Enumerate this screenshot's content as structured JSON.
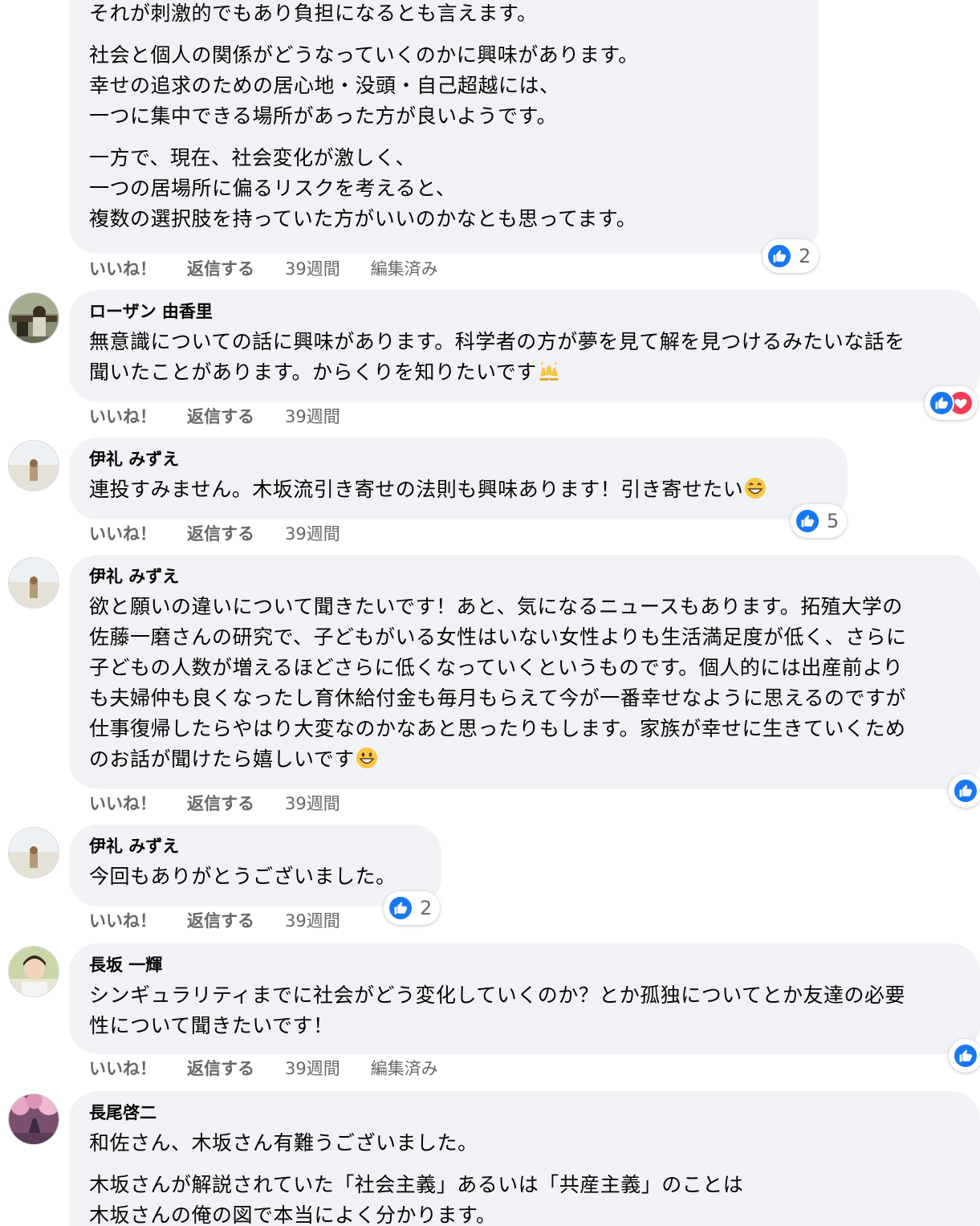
{
  "actions": {
    "like": "いいね！",
    "reply": "返信する"
  },
  "comments": [
    {
      "author": "",
      "paragraphs": [
        "それが刺激的でもあり負担になるとも言えます。",
        "社会と個人の関係がどうなっていくのかに興味があります。\n幸せの追求のための居心地・没頭・自己超越には、\n一つに集中できる場所があった方が良いようです。",
        "一方で、現在、社会変化が激しく、\n一つの居場所に偏るリスクを考えると、\n複数の選択肢を持っていた方がいいのかなとも思ってます。"
      ],
      "time": "39週間",
      "edited": "編集済み",
      "reaction_count": "2"
    },
    {
      "author": "ローザン 由香里",
      "paragraphs": [
        "無意識についての話に興味があります。科学者の方が夢を見て解を見つけるみたいな話を\n聞いたことがあります。からくりを知りたいです"
      ],
      "emoji": "raising-hands",
      "time": "39週間",
      "reactions": [
        "like",
        "love"
      ]
    },
    {
      "author": "伊礼 みずえ",
      "paragraphs": [
        "連投すみません。木坂流引き寄せの法則も興味あります！引き寄せたい"
      ],
      "emoji": "grinning",
      "time": "39週間",
      "reaction_count": "5"
    },
    {
      "author": "伊礼 みずえ",
      "paragraphs": [
        "欲と願いの違いについて聞きたいです！あと、気になるニュースもあります。拓殖大学の\n佐藤一磨さんの研究で、子どもがいる女性はいない女性よりも生活満足度が低く、さらに\n子どもの人数が増えるほどさらに低くなっていくというものです。個人的には出産前より\nも夫婦仲も良くなったし育休給付金も毎月もらえて今が一番幸せなように思えるのですが\n仕事復帰したらやはり大変なのかなあと思ったりもします。家族が幸せに生きていくため\nのお話が聞けたら嬉しいです"
      ],
      "emoji": "smile",
      "time": "39週間"
    },
    {
      "author": "伊礼 みずえ",
      "paragraphs": [
        "今回もありがとうございました。"
      ],
      "time": "39週間",
      "reaction_count": "2"
    },
    {
      "author": "長坂 一輝",
      "paragraphs": [
        "シンギュラリティまでに社会がどう変化していくのか？とか孤独についてとか友達の必要\n性について聞きたいです！"
      ],
      "time": "39週間",
      "edited": "編集済み"
    },
    {
      "author": "長尾啓二",
      "paragraphs": [
        "和佐さん、木坂さん有難うございました。",
        "木坂さんが解説されていた「社会主義」あるいは「共産主義」のことは\n木坂さんの俺の図で本当によく分かります。"
      ]
    }
  ]
}
